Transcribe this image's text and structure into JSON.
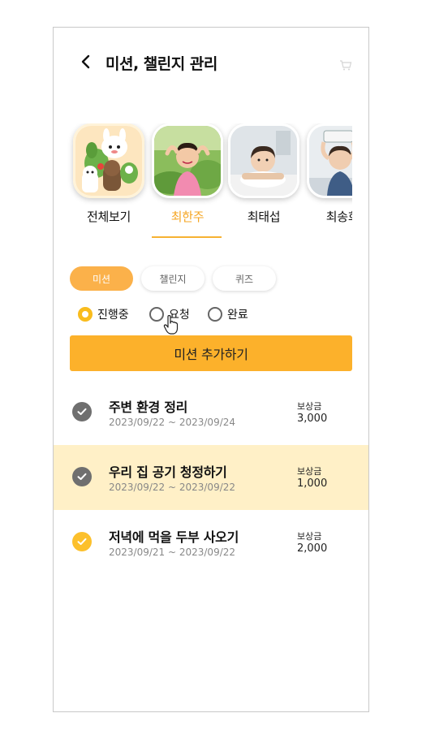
{
  "header": {
    "title": "미션, 챌린지 관리"
  },
  "profiles": [
    {
      "name": "전체보기",
      "active": false
    },
    {
      "name": "최한주",
      "active": true
    },
    {
      "name": "최태섭",
      "active": false
    },
    {
      "name": "최송희",
      "active": false
    }
  ],
  "tabs": [
    {
      "label": "미션",
      "active": true
    },
    {
      "label": "챌린지",
      "active": false
    },
    {
      "label": "퀴즈",
      "active": false
    }
  ],
  "filters": [
    {
      "label": "진행중",
      "checked": true
    },
    {
      "label": "요청",
      "checked": false
    },
    {
      "label": "완료",
      "checked": false
    }
  ],
  "add_button": "미션 추가하기",
  "missions": [
    {
      "title": "주변 환경 정리",
      "dates": "2023/09/22 ~ 2023/09/24",
      "reward_label": "보상금",
      "reward": "3,000"
    },
    {
      "title": "우리 집 공기 청정하기",
      "dates": "2023/09/22 ~ 2023/09/22",
      "reward_label": "보상금",
      "reward": "1,000"
    },
    {
      "title": "저녁에 먹을 두부 사오기",
      "dates": "2023/09/21 ~ 2023/09/22",
      "reward_label": "보상금",
      "reward": "2,000"
    }
  ],
  "colors": {
    "accent": "#fcb12b",
    "highlight": "#fff0c7",
    "active_text": "#f5a623"
  }
}
